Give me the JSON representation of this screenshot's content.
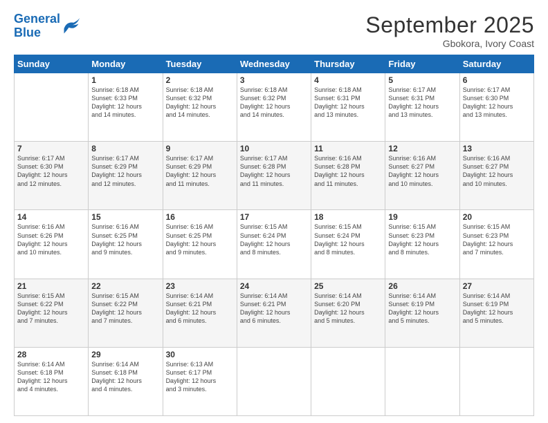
{
  "logo": {
    "line1": "General",
    "line2": "Blue"
  },
  "title": "September 2025",
  "location": "Gbokora, Ivory Coast",
  "header_days": [
    "Sunday",
    "Monday",
    "Tuesday",
    "Wednesday",
    "Thursday",
    "Friday",
    "Saturday"
  ],
  "weeks": [
    [
      {
        "num": "",
        "info": ""
      },
      {
        "num": "1",
        "info": "Sunrise: 6:18 AM\nSunset: 6:33 PM\nDaylight: 12 hours\nand 14 minutes."
      },
      {
        "num": "2",
        "info": "Sunrise: 6:18 AM\nSunset: 6:32 PM\nDaylight: 12 hours\nand 14 minutes."
      },
      {
        "num": "3",
        "info": "Sunrise: 6:18 AM\nSunset: 6:32 PM\nDaylight: 12 hours\nand 14 minutes."
      },
      {
        "num": "4",
        "info": "Sunrise: 6:18 AM\nSunset: 6:31 PM\nDaylight: 12 hours\nand 13 minutes."
      },
      {
        "num": "5",
        "info": "Sunrise: 6:17 AM\nSunset: 6:31 PM\nDaylight: 12 hours\nand 13 minutes."
      },
      {
        "num": "6",
        "info": "Sunrise: 6:17 AM\nSunset: 6:30 PM\nDaylight: 12 hours\nand 13 minutes."
      }
    ],
    [
      {
        "num": "7",
        "info": "Sunrise: 6:17 AM\nSunset: 6:30 PM\nDaylight: 12 hours\nand 12 minutes."
      },
      {
        "num": "8",
        "info": "Sunrise: 6:17 AM\nSunset: 6:29 PM\nDaylight: 12 hours\nand 12 minutes."
      },
      {
        "num": "9",
        "info": "Sunrise: 6:17 AM\nSunset: 6:29 PM\nDaylight: 12 hours\nand 11 minutes."
      },
      {
        "num": "10",
        "info": "Sunrise: 6:17 AM\nSunset: 6:28 PM\nDaylight: 12 hours\nand 11 minutes."
      },
      {
        "num": "11",
        "info": "Sunrise: 6:16 AM\nSunset: 6:28 PM\nDaylight: 12 hours\nand 11 minutes."
      },
      {
        "num": "12",
        "info": "Sunrise: 6:16 AM\nSunset: 6:27 PM\nDaylight: 12 hours\nand 10 minutes."
      },
      {
        "num": "13",
        "info": "Sunrise: 6:16 AM\nSunset: 6:27 PM\nDaylight: 12 hours\nand 10 minutes."
      }
    ],
    [
      {
        "num": "14",
        "info": "Sunrise: 6:16 AM\nSunset: 6:26 PM\nDaylight: 12 hours\nand 10 minutes."
      },
      {
        "num": "15",
        "info": "Sunrise: 6:16 AM\nSunset: 6:25 PM\nDaylight: 12 hours\nand 9 minutes."
      },
      {
        "num": "16",
        "info": "Sunrise: 6:16 AM\nSunset: 6:25 PM\nDaylight: 12 hours\nand 9 minutes."
      },
      {
        "num": "17",
        "info": "Sunrise: 6:15 AM\nSunset: 6:24 PM\nDaylight: 12 hours\nand 8 minutes."
      },
      {
        "num": "18",
        "info": "Sunrise: 6:15 AM\nSunset: 6:24 PM\nDaylight: 12 hours\nand 8 minutes."
      },
      {
        "num": "19",
        "info": "Sunrise: 6:15 AM\nSunset: 6:23 PM\nDaylight: 12 hours\nand 8 minutes."
      },
      {
        "num": "20",
        "info": "Sunrise: 6:15 AM\nSunset: 6:23 PM\nDaylight: 12 hours\nand 7 minutes."
      }
    ],
    [
      {
        "num": "21",
        "info": "Sunrise: 6:15 AM\nSunset: 6:22 PM\nDaylight: 12 hours\nand 7 minutes."
      },
      {
        "num": "22",
        "info": "Sunrise: 6:15 AM\nSunset: 6:22 PM\nDaylight: 12 hours\nand 7 minutes."
      },
      {
        "num": "23",
        "info": "Sunrise: 6:14 AM\nSunset: 6:21 PM\nDaylight: 12 hours\nand 6 minutes."
      },
      {
        "num": "24",
        "info": "Sunrise: 6:14 AM\nSunset: 6:21 PM\nDaylight: 12 hours\nand 6 minutes."
      },
      {
        "num": "25",
        "info": "Sunrise: 6:14 AM\nSunset: 6:20 PM\nDaylight: 12 hours\nand 5 minutes."
      },
      {
        "num": "26",
        "info": "Sunrise: 6:14 AM\nSunset: 6:19 PM\nDaylight: 12 hours\nand 5 minutes."
      },
      {
        "num": "27",
        "info": "Sunrise: 6:14 AM\nSunset: 6:19 PM\nDaylight: 12 hours\nand 5 minutes."
      }
    ],
    [
      {
        "num": "28",
        "info": "Sunrise: 6:14 AM\nSunset: 6:18 PM\nDaylight: 12 hours\nand 4 minutes."
      },
      {
        "num": "29",
        "info": "Sunrise: 6:14 AM\nSunset: 6:18 PM\nDaylight: 12 hours\nand 4 minutes."
      },
      {
        "num": "30",
        "info": "Sunrise: 6:13 AM\nSunset: 6:17 PM\nDaylight: 12 hours\nand 3 minutes."
      },
      {
        "num": "",
        "info": ""
      },
      {
        "num": "",
        "info": ""
      },
      {
        "num": "",
        "info": ""
      },
      {
        "num": "",
        "info": ""
      }
    ]
  ]
}
